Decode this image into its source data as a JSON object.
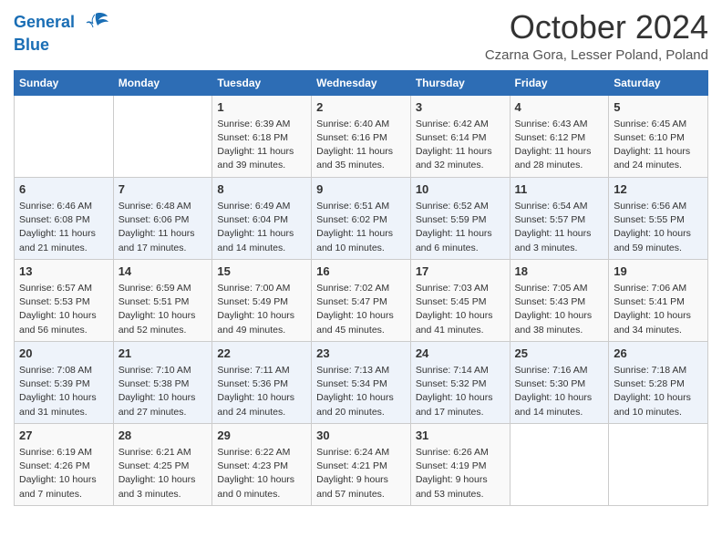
{
  "logo": {
    "line1": "General",
    "line2": "Blue"
  },
  "header": {
    "title": "October 2024",
    "subtitle": "Czarna Gora, Lesser Poland, Poland"
  },
  "days": [
    "Sunday",
    "Monday",
    "Tuesday",
    "Wednesday",
    "Thursday",
    "Friday",
    "Saturday"
  ],
  "weeks": [
    [
      {
        "num": "",
        "content": ""
      },
      {
        "num": "",
        "content": ""
      },
      {
        "num": "1",
        "content": "Sunrise: 6:39 AM\nSunset: 6:18 PM\nDaylight: 11 hours and 39 minutes."
      },
      {
        "num": "2",
        "content": "Sunrise: 6:40 AM\nSunset: 6:16 PM\nDaylight: 11 hours and 35 minutes."
      },
      {
        "num": "3",
        "content": "Sunrise: 6:42 AM\nSunset: 6:14 PM\nDaylight: 11 hours and 32 minutes."
      },
      {
        "num": "4",
        "content": "Sunrise: 6:43 AM\nSunset: 6:12 PM\nDaylight: 11 hours and 28 minutes."
      },
      {
        "num": "5",
        "content": "Sunrise: 6:45 AM\nSunset: 6:10 PM\nDaylight: 11 hours and 24 minutes."
      }
    ],
    [
      {
        "num": "6",
        "content": "Sunrise: 6:46 AM\nSunset: 6:08 PM\nDaylight: 11 hours and 21 minutes."
      },
      {
        "num": "7",
        "content": "Sunrise: 6:48 AM\nSunset: 6:06 PM\nDaylight: 11 hours and 17 minutes."
      },
      {
        "num": "8",
        "content": "Sunrise: 6:49 AM\nSunset: 6:04 PM\nDaylight: 11 hours and 14 minutes."
      },
      {
        "num": "9",
        "content": "Sunrise: 6:51 AM\nSunset: 6:02 PM\nDaylight: 11 hours and 10 minutes."
      },
      {
        "num": "10",
        "content": "Sunrise: 6:52 AM\nSunset: 5:59 PM\nDaylight: 11 hours and 6 minutes."
      },
      {
        "num": "11",
        "content": "Sunrise: 6:54 AM\nSunset: 5:57 PM\nDaylight: 11 hours and 3 minutes."
      },
      {
        "num": "12",
        "content": "Sunrise: 6:56 AM\nSunset: 5:55 PM\nDaylight: 10 hours and 59 minutes."
      }
    ],
    [
      {
        "num": "13",
        "content": "Sunrise: 6:57 AM\nSunset: 5:53 PM\nDaylight: 10 hours and 56 minutes."
      },
      {
        "num": "14",
        "content": "Sunrise: 6:59 AM\nSunset: 5:51 PM\nDaylight: 10 hours and 52 minutes."
      },
      {
        "num": "15",
        "content": "Sunrise: 7:00 AM\nSunset: 5:49 PM\nDaylight: 10 hours and 49 minutes."
      },
      {
        "num": "16",
        "content": "Sunrise: 7:02 AM\nSunset: 5:47 PM\nDaylight: 10 hours and 45 minutes."
      },
      {
        "num": "17",
        "content": "Sunrise: 7:03 AM\nSunset: 5:45 PM\nDaylight: 10 hours and 41 minutes."
      },
      {
        "num": "18",
        "content": "Sunrise: 7:05 AM\nSunset: 5:43 PM\nDaylight: 10 hours and 38 minutes."
      },
      {
        "num": "19",
        "content": "Sunrise: 7:06 AM\nSunset: 5:41 PM\nDaylight: 10 hours and 34 minutes."
      }
    ],
    [
      {
        "num": "20",
        "content": "Sunrise: 7:08 AM\nSunset: 5:39 PM\nDaylight: 10 hours and 31 minutes."
      },
      {
        "num": "21",
        "content": "Sunrise: 7:10 AM\nSunset: 5:38 PM\nDaylight: 10 hours and 27 minutes."
      },
      {
        "num": "22",
        "content": "Sunrise: 7:11 AM\nSunset: 5:36 PM\nDaylight: 10 hours and 24 minutes."
      },
      {
        "num": "23",
        "content": "Sunrise: 7:13 AM\nSunset: 5:34 PM\nDaylight: 10 hours and 20 minutes."
      },
      {
        "num": "24",
        "content": "Sunrise: 7:14 AM\nSunset: 5:32 PM\nDaylight: 10 hours and 17 minutes."
      },
      {
        "num": "25",
        "content": "Sunrise: 7:16 AM\nSunset: 5:30 PM\nDaylight: 10 hours and 14 minutes."
      },
      {
        "num": "26",
        "content": "Sunrise: 7:18 AM\nSunset: 5:28 PM\nDaylight: 10 hours and 10 minutes."
      }
    ],
    [
      {
        "num": "27",
        "content": "Sunrise: 6:19 AM\nSunset: 4:26 PM\nDaylight: 10 hours and 7 minutes."
      },
      {
        "num": "28",
        "content": "Sunrise: 6:21 AM\nSunset: 4:25 PM\nDaylight: 10 hours and 3 minutes."
      },
      {
        "num": "29",
        "content": "Sunrise: 6:22 AM\nSunset: 4:23 PM\nDaylight: 10 hours and 0 minutes."
      },
      {
        "num": "30",
        "content": "Sunrise: 6:24 AM\nSunset: 4:21 PM\nDaylight: 9 hours and 57 minutes."
      },
      {
        "num": "31",
        "content": "Sunrise: 6:26 AM\nSunset: 4:19 PM\nDaylight: 9 hours and 53 minutes."
      },
      {
        "num": "",
        "content": ""
      },
      {
        "num": "",
        "content": ""
      }
    ]
  ]
}
